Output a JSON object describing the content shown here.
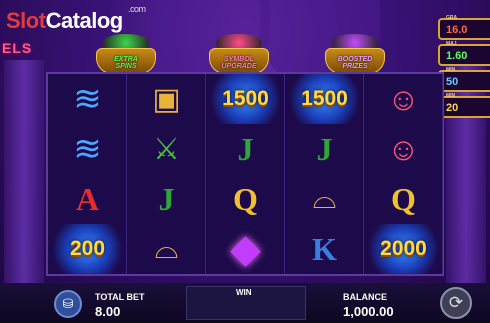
{
  "watermark": {
    "slot": "Slot",
    "catalog": "Catalog",
    "dotcom": ".com"
  },
  "title_fragment": "ELS",
  "pots": [
    {
      "label_line1": "EXTRA",
      "label_line2": "SPINS",
      "gem_color": "#3fd64b",
      "label_color": "#4cff5a"
    },
    {
      "label_line1": "SYMBOL",
      "label_line2": "UPGRADE",
      "gem_color": "#ff4b8c",
      "label_color": "#ff7bb0"
    },
    {
      "label_line1": "BOOSTED",
      "label_line2": "PRIZES",
      "gem_color": "#c34cff",
      "label_color": "#ee9bff"
    }
  ],
  "jackpots": [
    {
      "label": "GRA",
      "value": "16.0",
      "color": "#ff6b3d"
    },
    {
      "label": "MAJ",
      "value": "1.60",
      "color": "#5aff5a"
    },
    {
      "label": "MIN",
      "value": "50",
      "color": "#6fc8ff"
    },
    {
      "label": "MIN",
      "value": "20",
      "color": "#ffd84a"
    }
  ],
  "reels": [
    [
      {
        "type": "icon",
        "icon": "magic-carpet-icon",
        "glyph": "≋"
      },
      {
        "type": "icon",
        "icon": "magic-carpet-icon",
        "glyph": "≋"
      },
      {
        "type": "letter",
        "text": "A",
        "color": "#e82b2b"
      },
      {
        "type": "number",
        "text": "200"
      }
    ],
    [
      {
        "type": "icon",
        "icon": "treasure-chest-icon",
        "glyph": "▣"
      },
      {
        "type": "icon",
        "icon": "dagger-icon",
        "glyph": "⚔"
      },
      {
        "type": "letter",
        "text": "J",
        "color": "#2fa63a"
      },
      {
        "type": "icon",
        "icon": "magic-lamp-icon",
        "glyph": "⌓"
      }
    ],
    [
      {
        "type": "number",
        "text": "1500"
      },
      {
        "type": "letter",
        "text": "J",
        "color": "#2fa63a"
      },
      {
        "type": "letter",
        "text": "Q",
        "color": "#f0c030"
      },
      {
        "type": "icon",
        "icon": "purple-gem-icon",
        "glyph": "◆"
      }
    ],
    [
      {
        "type": "number",
        "text": "1500"
      },
      {
        "type": "letter",
        "text": "J",
        "color": "#2fa63a"
      },
      {
        "type": "icon",
        "icon": "magic-lamp-icon",
        "glyph": "⌓"
      },
      {
        "type": "letter",
        "text": "K",
        "color": "#3a7ee0"
      }
    ],
    [
      {
        "type": "icon",
        "icon": "genie-icon",
        "glyph": "☺"
      },
      {
        "type": "icon",
        "icon": "genie-icon",
        "glyph": "☺"
      },
      {
        "type": "letter",
        "text": "Q",
        "color": "#f0c030"
      },
      {
        "type": "number",
        "text": "2000"
      }
    ]
  ],
  "bottom": {
    "total_bet_label": "TOTAL BET",
    "total_bet_value": "8.00",
    "win_label": "WIN",
    "balance_label": "BALANCE",
    "balance_value": "1,000.00"
  }
}
